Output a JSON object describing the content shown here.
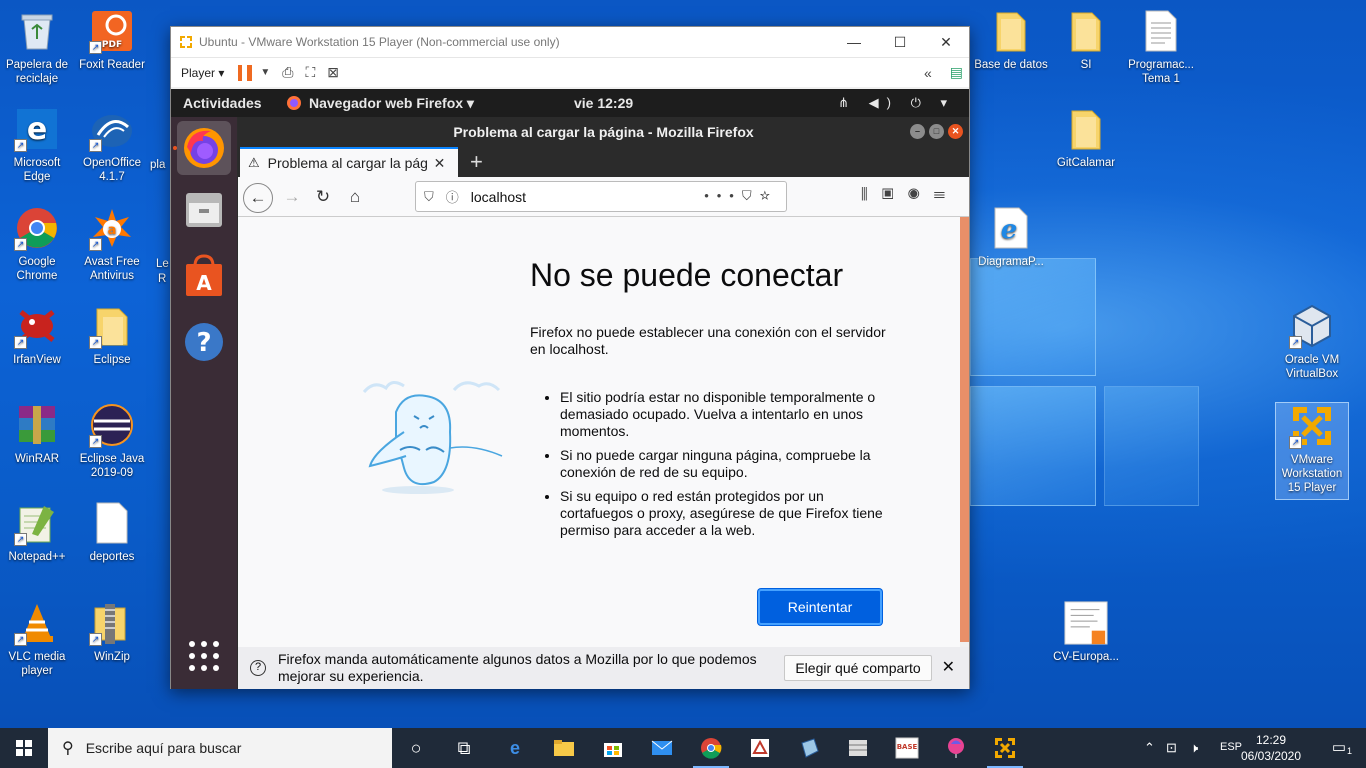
{
  "colors": {
    "desktop_blue": "#0a63c9",
    "taskbar": "#1f2a39",
    "ubuntu_orange": "#e95420",
    "firefox_blue": "#0060df"
  },
  "desktop_icons_left": [
    {
      "label": "Papelera de reciclaje",
      "icon": "recycle-bin-icon"
    },
    {
      "label": "Foxit Reader",
      "icon": "foxit-pdf-icon"
    },
    {
      "label": "Microsoft Edge",
      "icon": "edge-icon"
    },
    {
      "label": "OpenOffice 4.1.7",
      "icon": "openoffice-icon"
    },
    {
      "label": "Google Chrome",
      "icon": "chrome-icon"
    },
    {
      "label": "Avast Free Antivirus",
      "icon": "avast-icon"
    },
    {
      "label": "IrfanView",
      "icon": "irfanview-icon"
    },
    {
      "label": "Eclipse",
      "icon": "folder-icon"
    },
    {
      "label": "WinRAR",
      "icon": "winrar-icon"
    },
    {
      "label": "Eclipse Java 2019-09",
      "icon": "eclipse-icon"
    },
    {
      "label": "Notepad++",
      "icon": "notepadpp-icon"
    },
    {
      "label": "deportes",
      "icon": "document-icon"
    },
    {
      "label": "VLC media player",
      "icon": "vlc-icon"
    },
    {
      "label": "WinZip",
      "icon": "winzip-icon"
    }
  ],
  "desktop_icons_right": [
    {
      "label": "Base de datos",
      "icon": "folder-icon"
    },
    {
      "label": "SI",
      "icon": "folder-icon"
    },
    {
      "label": "Programac... Tema 1",
      "icon": "document-icon"
    },
    {
      "label": "GitCalamar",
      "icon": "folder-icon"
    },
    {
      "label": "DiagramaP...",
      "icon": "ie-icon"
    },
    {
      "label": "Oracle VM VirtualBox",
      "icon": "virtualbox-icon"
    },
    {
      "label": "VMware Workstation 15 Player",
      "icon": "vmware-icon"
    },
    {
      "label": "CV-Europa...",
      "icon": "document-icon"
    }
  ],
  "desktop_partial_labels": {
    "edge_col3_a": "pla",
    "edge_col3_b": "Le",
    "edge_col3_c": "R"
  },
  "vmware": {
    "title": "Ubuntu - VMware Workstation 15 Player (Non-commercial use only)",
    "player_menu": "Player ▾",
    "minimize": "—",
    "maximize": "☐",
    "close": "✕",
    "collapse": "«"
  },
  "gnome": {
    "activities": "Actividades",
    "app_name": "Navegador web Firefox ▾",
    "clock": "vie 12:29",
    "system_tray": "⋔ ◀) ⏻ ▾"
  },
  "firefox": {
    "window_title": "Problema al cargar la página - Mozilla Firefox",
    "tab_title": "Problema al cargar la pág",
    "new_tab": "+",
    "url": "localhost",
    "error_title": "No se puede conectar",
    "error_description": "Firefox no puede establecer una conexión con el servidor en localhost.",
    "error_bullets": [
      "El sitio podría estar no disponible temporalmente o demasiado ocupado. Vuelva a intentarlo en unos momentos.",
      "Si no puede cargar ninguna página, compruebe la conexión de red de su equipo.",
      "Si su equipo o red están protegidos por un cortafuegos o proxy, asegúrese de que Firefox tiene permiso para acceder a la web."
    ],
    "retry_button": "Reintentar",
    "notification_text": "Firefox manda automáticamente algunos datos a Mozilla por lo que podemos mejorar su experiencia.",
    "notification_button": "Elegir qué comparto",
    "notification_close": "✕",
    "scroll_position": 0.0
  },
  "taskbar": {
    "search_placeholder": "Escribe aquí para buscar",
    "language": "ESP",
    "time": "12:29",
    "date": "06/03/2020",
    "notification_count": "1"
  }
}
